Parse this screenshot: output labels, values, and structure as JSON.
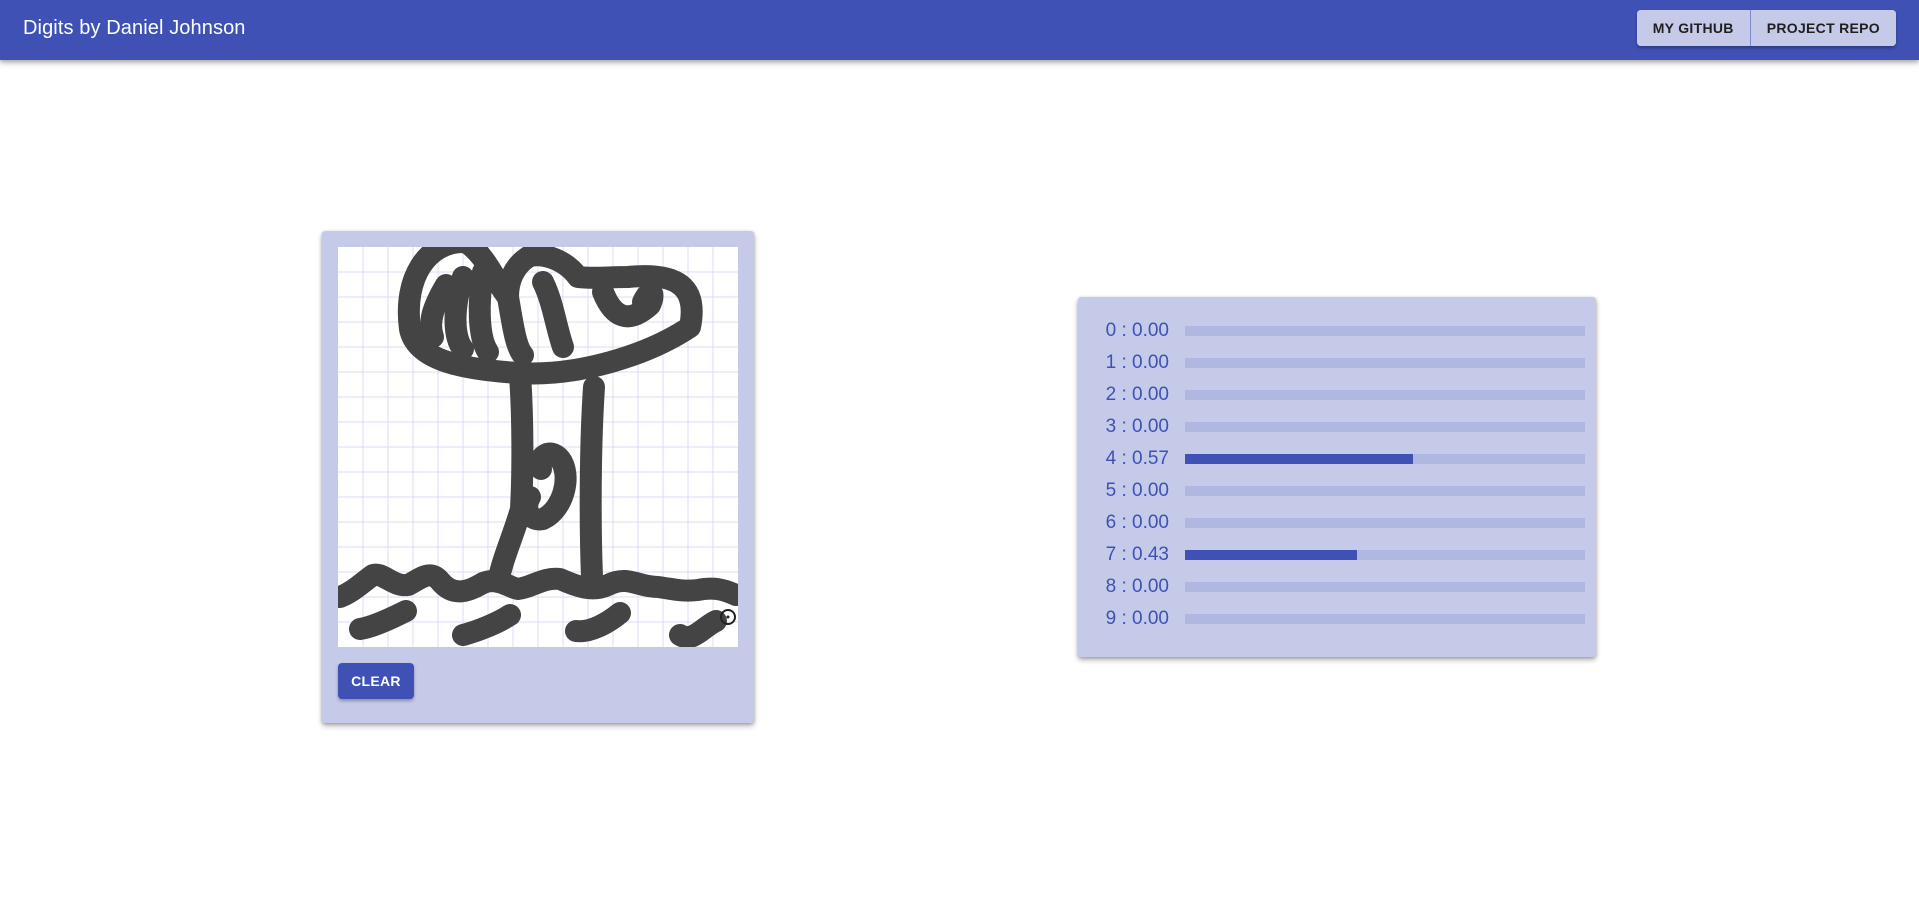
{
  "appbar": {
    "title": "Digits by Daniel Johnson",
    "buttons": [
      {
        "label": "MY GITHUB"
      },
      {
        "label": "PROJECT REPO"
      }
    ]
  },
  "drawing": {
    "clear_label": "CLEAR"
  },
  "predictions": [
    {
      "digit": 0,
      "label": "0 : 0.00",
      "value": 0.0
    },
    {
      "digit": 1,
      "label": "1 : 0.00",
      "value": 0.0
    },
    {
      "digit": 2,
      "label": "2 : 0.00",
      "value": 0.0
    },
    {
      "digit": 3,
      "label": "3 : 0.00",
      "value": 0.0
    },
    {
      "digit": 4,
      "label": "4 : 0.57",
      "value": 0.57
    },
    {
      "digit": 5,
      "label": "5 : 0.00",
      "value": 0.0
    },
    {
      "digit": 6,
      "label": "6 : 0.00",
      "value": 0.0
    },
    {
      "digit": 7,
      "label": "7 : 0.43",
      "value": 0.43
    },
    {
      "digit": 8,
      "label": "8 : 0.00",
      "value": 0.0
    },
    {
      "digit": 9,
      "label": "9 : 0.00",
      "value": 0.0
    }
  ],
  "colors": {
    "primary": "#3f51b5",
    "primary_light": "#c5cae9",
    "track": "#b0b7e0",
    "ink": "#444444"
  }
}
